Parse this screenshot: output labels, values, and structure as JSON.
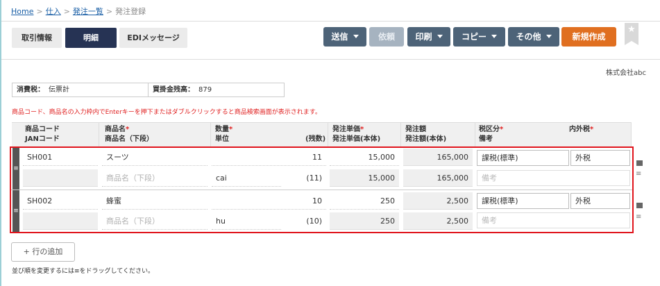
{
  "breadcrumb": {
    "home": "Home",
    "purchase": "仕入",
    "order_list": "発注一覧",
    "current": "発注登録"
  },
  "tabs": [
    {
      "label": "取引情報"
    },
    {
      "label": "明細"
    },
    {
      "label": "EDIメッセージ"
    }
  ],
  "actions": {
    "send": "送信",
    "request": "依頼",
    "print": "印刷",
    "copy": "コピー",
    "other": "その他",
    "new": "新規作成"
  },
  "company": "株式会社abc",
  "info": {
    "tax_label": "消費税：",
    "tax_value": "伝票計",
    "balance_label": "買掛金残高：",
    "balance_value": "879"
  },
  "notice": "商品コード、商品名の入力枠内でEnterキーを押下またはダブルクリックすると商品検索画面が表示されます。",
  "headers": {
    "code": "商品コード",
    "jan": "JANコード",
    "name": "商品名",
    "name2": "商品名（下段）",
    "qty": "数量",
    "unit": "単位",
    "remaining": "(残数)",
    "price": "発注単価",
    "price_net": "発注単価(本体)",
    "amount": "発注額",
    "amount_net": "発注額(本体)",
    "tax_class": "税区分",
    "memo": "備考",
    "tax_incl": "内外税",
    "required_mark": "*"
  },
  "rows": [
    {
      "code": "SH001",
      "name": "スーツ",
      "name2_placeholder": "商品名（下段）",
      "qty": "11",
      "unit": "cai",
      "remaining": "(11)",
      "price": "15,000",
      "price_net": "15,000",
      "amount": "165,000",
      "amount_net": "165,000",
      "tax_class": "課税(標準)",
      "tax_incl": "外税",
      "memo_placeholder": "備考"
    },
    {
      "code": "SH002",
      "name": "蜂蜜",
      "name2_placeholder": "商品名（下段）",
      "qty": "10",
      "unit": "hu",
      "remaining": "(10)",
      "price": "250",
      "price_net": "250",
      "amount": "2,500",
      "amount_net": "2,500",
      "tax_class": "課税(標準)",
      "tax_incl": "外税",
      "memo_placeholder": "備考"
    }
  ],
  "add_row": "+ 行の追加",
  "drag_hint": "並び順を変更するには≡をドラッグしてください。",
  "colors": {
    "active_tab": "#263354",
    "action_button": "#4d6378",
    "new_button": "#e06f20",
    "selection_border": "#e0141c",
    "required": "#e02020"
  }
}
